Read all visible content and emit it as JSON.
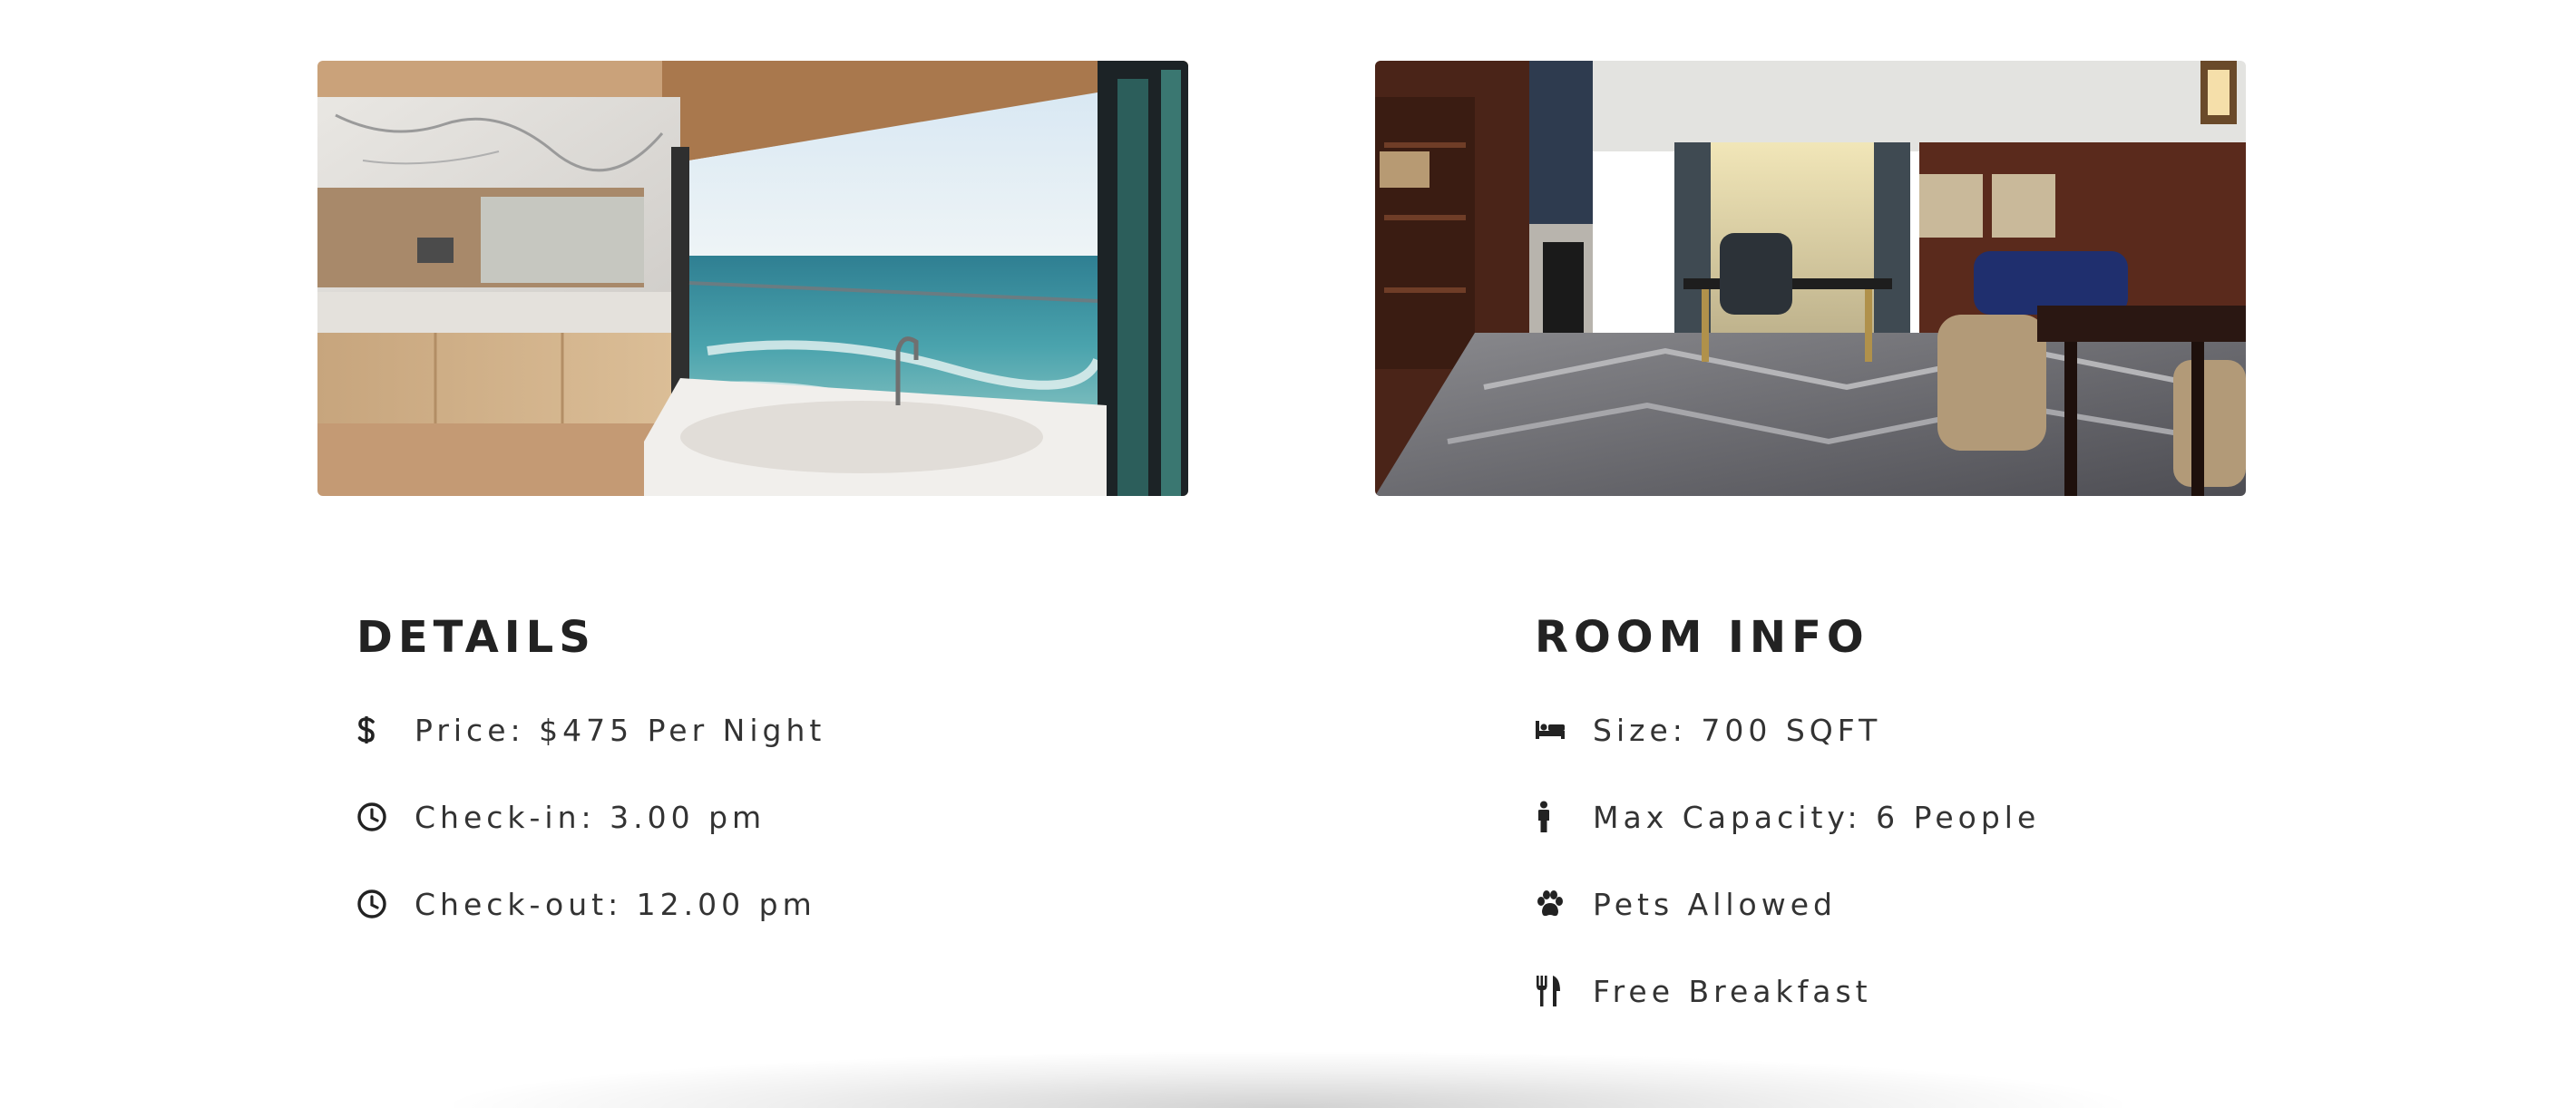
{
  "images": {
    "left": {
      "alt": "Bathroom with ocean view"
    },
    "right": {
      "alt": "Suite living room"
    }
  },
  "details": {
    "heading": "DETAILS",
    "items": [
      {
        "icon": "dollar-icon",
        "label": "Price: $475 Per Night"
      },
      {
        "icon": "clock-icon",
        "label": "Check-in: 3.00 pm"
      },
      {
        "icon": "clock-icon",
        "label": "Check-out: 12.00 pm"
      }
    ]
  },
  "room_info": {
    "heading": "ROOM INFO",
    "items": [
      {
        "icon": "bed-icon",
        "label": "Size: 700 SQFT"
      },
      {
        "icon": "person-icon",
        "label": "Max Capacity: 6 People"
      },
      {
        "icon": "paw-icon",
        "label": "Pets Allowed"
      },
      {
        "icon": "utensils-icon",
        "label": "Free Breakfast"
      }
    ]
  },
  "colors": {
    "text": "#222222",
    "background": "#ffffff"
  }
}
